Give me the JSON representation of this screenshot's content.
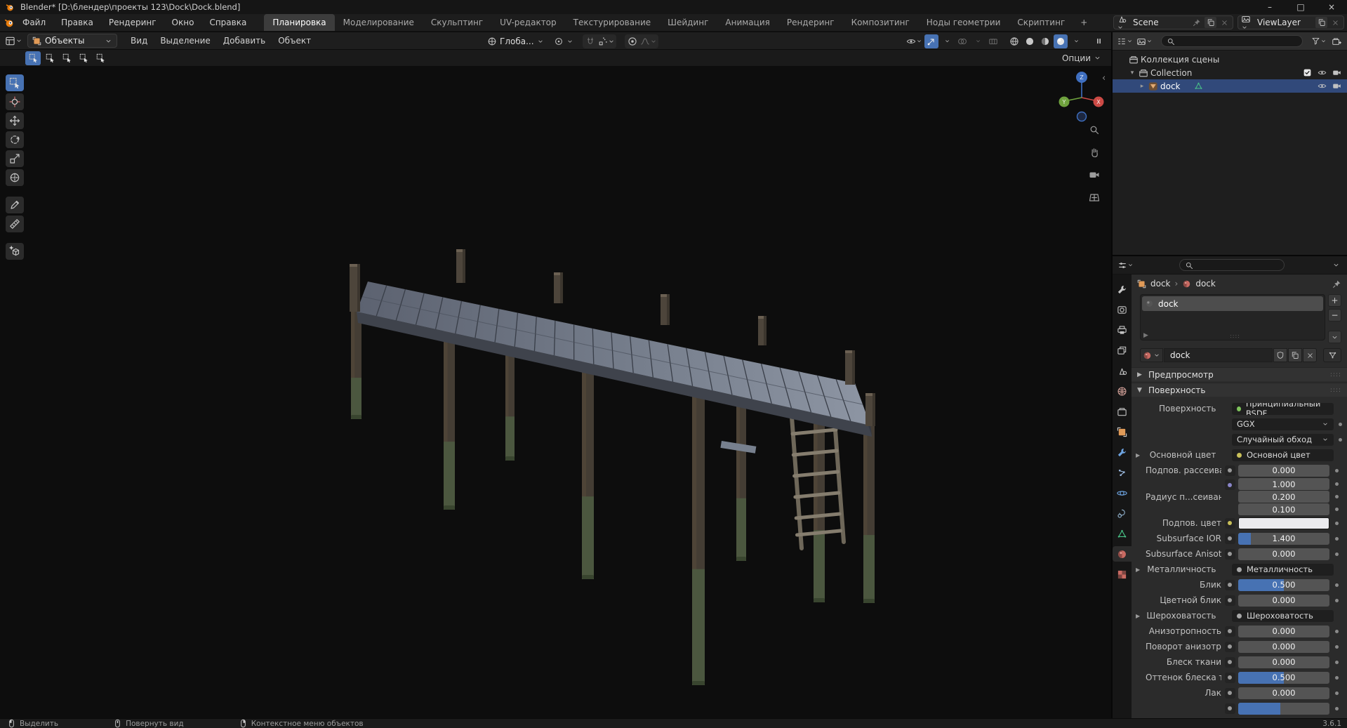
{
  "window": {
    "title": "Blender* [D:\\блендер\\проекты 123\\Dock\\Dock.blend]",
    "minimize_label": "–",
    "maximize_label": "□",
    "close_label": "×"
  },
  "menubar": {
    "menus": [
      "Файл",
      "Правка",
      "Рендеринг",
      "Окно",
      "Справка"
    ],
    "workspaces": [
      "Планировка",
      "Моделирование",
      "Скульптинг",
      "UV-редактор",
      "Текстурирование",
      "Шейдинг",
      "Анимация",
      "Рендеринг",
      "Композитинг",
      "Ноды геометрии",
      "Скриптинг"
    ],
    "active_workspace": "Планировка",
    "add_workspace_label": "+",
    "scene": {
      "label": "Scene"
    },
    "view_layer": {
      "label": "ViewLayer"
    }
  },
  "viewport": {
    "header": {
      "mode": "Объекты",
      "menus": [
        "Вид",
        "Выделение",
        "Добавить",
        "Объект"
      ],
      "orientation": "Глоба...",
      "shading_modes": [
        "wireframe",
        "solid",
        "material",
        "rendered"
      ],
      "active_shading": "rendered"
    },
    "tool_settings": {
      "options_label": "Опции",
      "select_modes": [
        "select-new",
        "select-extend",
        "select-subtract",
        "select-invert",
        "select-intersect"
      ],
      "active_select_mode": "select-new"
    },
    "tools": [
      "tool-select",
      "tool-cursor",
      "tool-move",
      "tool-rotate",
      "tool-scale",
      "tool-transform",
      "tool-annotate",
      "tool-measure",
      "tool-add-cube"
    ],
    "active_tool": "tool-select",
    "gizmo": {
      "x_label": "X",
      "y_label": "Y",
      "z_label": "Z",
      "x_color": "#cc4a45",
      "y_color": "#6fa23e",
      "z_color": "#3f6fc0"
    }
  },
  "outliner": {
    "rows": [
      {
        "label": "Коллекция сцены",
        "type": "scene-collection",
        "indent": 0,
        "toggles": []
      },
      {
        "label": "Collection",
        "type": "collection",
        "indent": 1,
        "disclosure": "▾",
        "toggles": [
          "checkbox",
          "eye",
          "camera"
        ]
      },
      {
        "label": "dock",
        "type": "object",
        "indent": 2,
        "disclosure": "▸",
        "selected": true,
        "toggles": [
          "eye",
          "camera"
        ]
      }
    ]
  },
  "properties": {
    "tabs": [
      "tool",
      "render",
      "output",
      "view-layer",
      "scene",
      "world",
      "collection",
      "object",
      "modifiers",
      "particles",
      "physics",
      "constraints",
      "data",
      "material",
      "texture"
    ],
    "active_tab": "material",
    "breadcrumb": {
      "object": "dock",
      "separator": "›",
      "material": "dock"
    },
    "slots": [
      {
        "name": "dock",
        "selected": true
      }
    ],
    "slot_add_label": "+",
    "slot_remove_label": "−",
    "material_name": "dock",
    "panels": {
      "preview": "Предпросмотр",
      "surface": "Поверхность"
    },
    "surface_rows": [
      {
        "label": "Поверхность",
        "type": "node",
        "text": "Принципиальный BSDF",
        "dot": "#7fc45c"
      },
      {
        "label": "",
        "type": "dropdown",
        "text": "GGX"
      },
      {
        "label": "",
        "type": "dropdown",
        "text": "Случайный обход"
      },
      {
        "label": "Основной цвет",
        "expand": true,
        "type": "node",
        "text": "Основной цвет",
        "dot": "#c9c05a"
      },
      {
        "label": "Подпов. рассеива...",
        "type": "slider",
        "value": "0.000",
        "fill": 0
      },
      {
        "label": "Радиус п...сеивания",
        "type": "multi",
        "values": [
          "1.000",
          "0.200",
          "0.100"
        ],
        "socket": "#8a86c9"
      },
      {
        "label": "Подпов. цвет",
        "type": "color",
        "color": "#ebebee",
        "socket": "#c9c05a"
      },
      {
        "label": "Subsurface IOR",
        "type": "slider",
        "value": "1.400",
        "fill": 14
      },
      {
        "label": "Subsurface Anisotr...",
        "type": "slider",
        "value": "0.000",
        "fill": 0
      },
      {
        "label": "Металличность",
        "expand": true,
        "type": "node",
        "text": "Металличность",
        "dot": "#a8a8a8"
      },
      {
        "label": "Блик",
        "type": "slider",
        "value": "0.500",
        "fill": 50
      },
      {
        "label": "Цветной блик",
        "type": "slider",
        "value": "0.000",
        "fill": 0
      },
      {
        "label": "Шероховатость",
        "expand": true,
        "type": "node",
        "text": "Шероховатость",
        "dot": "#a8a8a8"
      },
      {
        "label": "Анизотропность",
        "type": "slider",
        "value": "0.000",
        "fill": 0
      },
      {
        "label": "Поворот анизотро...",
        "type": "slider",
        "value": "0.000",
        "fill": 0
      },
      {
        "label": "Блеск ткани",
        "type": "slider",
        "value": "0.000",
        "fill": 0
      },
      {
        "label": "Оттенок блеска тк...",
        "type": "slider",
        "value": "0.500",
        "fill": 50
      },
      {
        "label": "Лак",
        "type": "slider",
        "value": "0.000",
        "fill": 0
      },
      {
        "label": "",
        "type": "slider",
        "value": "",
        "fill": 46,
        "cropped": true
      }
    ]
  },
  "statusbar": {
    "hints": [
      {
        "icon": "mouse-left",
        "label": "Выделить"
      },
      {
        "icon": "mouse-middle",
        "label": "Повернуть вид"
      },
      {
        "icon": "mouse-right",
        "label": "Контекстное меню объектов"
      }
    ],
    "version": "3.6.1"
  },
  "colors": {
    "accent": "#4772b3",
    "selection": "#31497a",
    "viewport_bg": "#0d0d0d"
  }
}
